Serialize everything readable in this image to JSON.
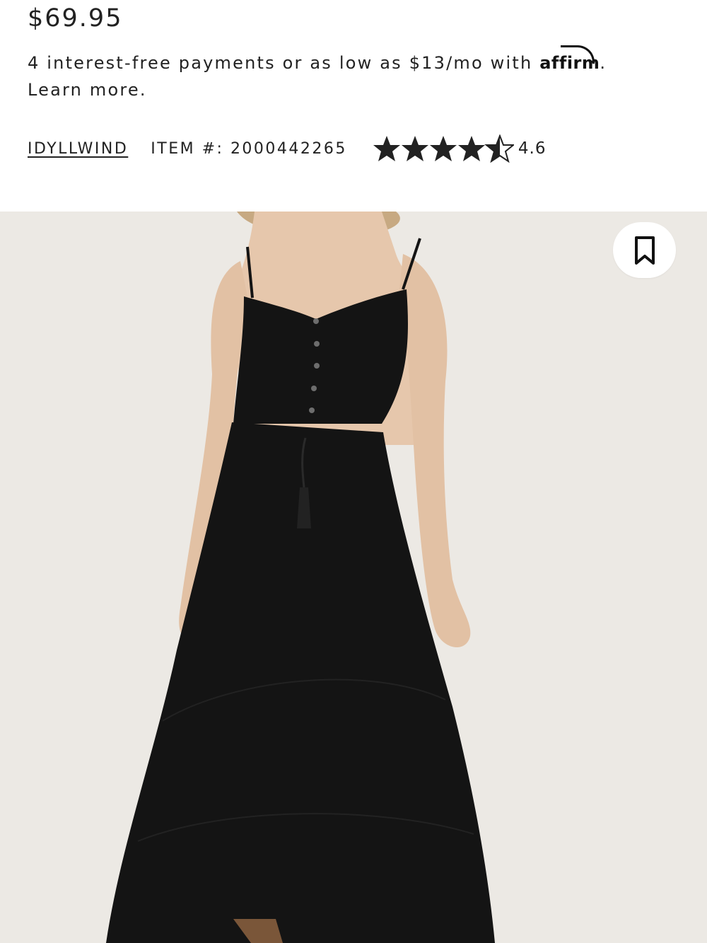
{
  "product": {
    "price": "$69.95",
    "financing_text": "4 interest-free payments or as low as $13/mo with ",
    "financing_provider": "affirm",
    "financing_period": ".",
    "learn_more": "Learn more.",
    "brand": "IDYLLWIND",
    "item_number": "ITEM #: 2000442265",
    "rating": "4.6",
    "rating_value": 4.6,
    "rating_max": 5
  },
  "icons": {
    "bookmark": "bookmark-icon",
    "star_full": "star-full-icon",
    "star_half": "star-half-icon"
  },
  "colors": {
    "text": "#222222",
    "image_background": "#ece9e4",
    "dress": "#141414"
  }
}
